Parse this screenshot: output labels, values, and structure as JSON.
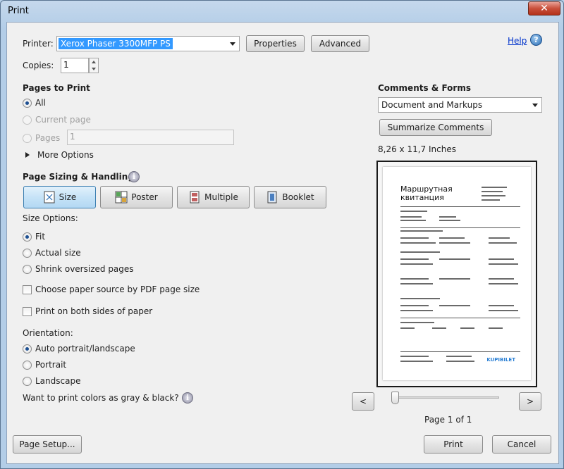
{
  "window": {
    "title": "Print",
    "close_glyph": "✕"
  },
  "printer": {
    "label": "Printer:",
    "selected": "Xerox Phaser 3300MFP PS",
    "properties_button": "Properties",
    "advanced_button": "Advanced",
    "copies_label": "Copies:",
    "copies_value": "1"
  },
  "help": {
    "link": "Help",
    "icon_glyph": "?"
  },
  "pages_to_print": {
    "heading": "Pages to Print",
    "options": [
      "All",
      "Current page",
      "Pages"
    ],
    "pages_value": "1",
    "more_options": "More Options"
  },
  "page_sizing": {
    "heading": "Page Sizing & Handling",
    "info_glyph": "i",
    "tabs": [
      "Size",
      "Poster",
      "Multiple",
      "Booklet"
    ],
    "size_options_label": "Size Options:",
    "size_options": [
      "Fit",
      "Actual size",
      "Shrink oversized pages"
    ],
    "choose_paper_source": "Choose paper source by PDF page size",
    "print_both_sides": "Print on both sides of paper"
  },
  "orientation": {
    "label": "Orientation:",
    "options": [
      "Auto portrait/landscape",
      "Portrait",
      "Landscape"
    ]
  },
  "gray_question": "Want to print colors as gray & black?",
  "comments_forms": {
    "heading": "Comments & Forms",
    "selected": "Document and Markups",
    "summarize_button": "Summarize Comments"
  },
  "preview": {
    "page_size": "8,26 x 11,7 Inches",
    "doc_title_line1": "Маршрутная",
    "doc_title_line2": "квитанция",
    "doc_logo": "KUPIBILET",
    "prev_glyph": "<",
    "next_glyph": ">",
    "page_indicator": "Page 1 of 1"
  },
  "footer": {
    "page_setup_button": "Page Setup...",
    "print_button": "Print",
    "cancel_button": "Cancel"
  },
  "colors": {
    "title_bar": "#b3cde7",
    "close_red": "#c9503b",
    "accent": "#3399ff"
  }
}
